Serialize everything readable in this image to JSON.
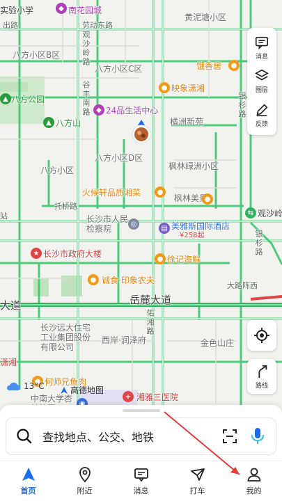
{
  "map": {
    "labels": {
      "top_school": "实验小学",
      "top_mall": "南花园城",
      "top_community": "黄泥塘小区",
      "road_top1": "出路",
      "road_top2": "劳动东路",
      "bafang_b": "八方小区B区",
      "bafang_c": "八方小区C区",
      "bafang_park": "八方公园",
      "bafang_hill": "八方山",
      "shop_24": "24品生活中心",
      "bafang_d": "八方小区D区",
      "bafang_c2": "八方小区",
      "yingxiang": "映象潇湘",
      "yingxiang_top": "饿香居",
      "juzhou": "橘洲新苑",
      "fenglin": "枫林绿洲小区",
      "fenglin_mei": "枫林美景",
      "huohou": "火候轩品质湘菜",
      "tuoqiao": "托桥路",
      "jianchayuan": "长沙市人民检察院",
      "meiyas": "美雅斯国际酒店",
      "meiyas_price": "¥258起",
      "guanshahu": "观沙岭",
      "govt": "长沙市政府大楼",
      "xuji": "徐记海鲜",
      "chengshi": "诚食·印象农夫",
      "yuelu": "岳麓大道",
      "yuelu_left": "大道",
      "dalu": "大路阵西",
      "far_east": "长沙远大住宅工业集团股份有限公司",
      "xiyuan": "西岸·润泽府",
      "jinse": "金色山庄",
      "xiaoxiang": "潇湘",
      "hegou": "何师兄鱼肉",
      "zhongnan": "中南大学杏林校区",
      "xiangya": "湘雅三医院",
      "vertical_road1": "观沙岭路",
      "vertical_road2": "银杉路",
      "vertical_road3": "银杉路",
      "vertical_road4": "佑湘路",
      "vertical_road5": "谷丰南路",
      "left_station": "站",
      "right_road": "观沙岭"
    },
    "weather_temp": "13°C",
    "logo_text": "高德地图"
  },
  "side_panel": {
    "message_label": "消息",
    "layers_label": "图层",
    "feedback_label": "反馈"
  },
  "locate": {
    "route_label": "路线"
  },
  "search": {
    "placeholder": "查找地点、公交、地铁"
  },
  "tabs": [
    {
      "label": "首页"
    },
    {
      "label": "附近"
    },
    {
      "label": "消息"
    },
    {
      "label": "打车"
    },
    {
      "label": "我的"
    }
  ],
  "colors": {
    "accent": "#1a6cf0",
    "road_green": "#2fc86a",
    "annotation": "#e83a3a"
  }
}
